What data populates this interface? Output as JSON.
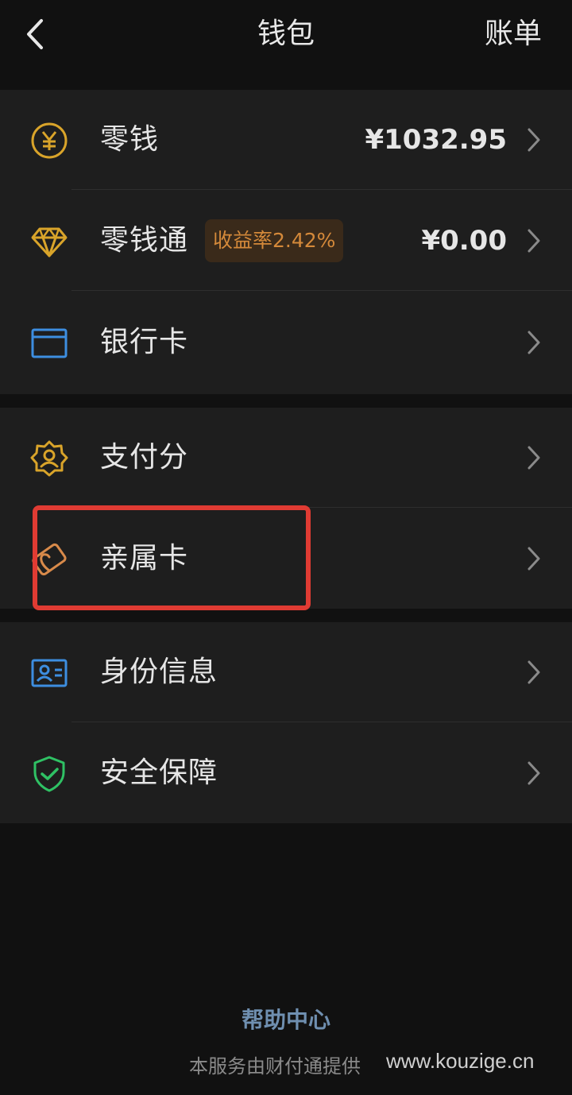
{
  "header": {
    "title": "钱包",
    "bill_label": "账单"
  },
  "colors": {
    "gold": "#d9a42a",
    "blue": "#3d8ee0",
    "green": "#2fc164",
    "badge_text": "#d4893a",
    "badge_bg": "#3a2a1a",
    "highlight": "#e03b33",
    "help_link": "#6f8fb0"
  },
  "wallet": {
    "change": {
      "label": "零钱",
      "value": "¥1032.95",
      "icon": "yen-coin-icon"
    },
    "change_plus": {
      "label": "零钱通",
      "badge": "收益率2.42%",
      "value": "¥0.00",
      "icon": "diamond-icon"
    },
    "bank_card": {
      "label": "银行卡",
      "icon": "bank-card-icon"
    }
  },
  "services": {
    "pay_score": {
      "label": "支付分",
      "icon": "pay-score-badge-icon"
    },
    "family_card": {
      "label": "亲属卡",
      "icon": "family-card-icon"
    }
  },
  "account": {
    "identity": {
      "label": "身份信息",
      "icon": "id-card-icon"
    },
    "security": {
      "label": "安全保障",
      "icon": "shield-check-icon"
    }
  },
  "footer": {
    "help_center": "帮助中心",
    "provider_note": "本服务由财付通提供",
    "watermark": "www.kouzige.cn"
  }
}
